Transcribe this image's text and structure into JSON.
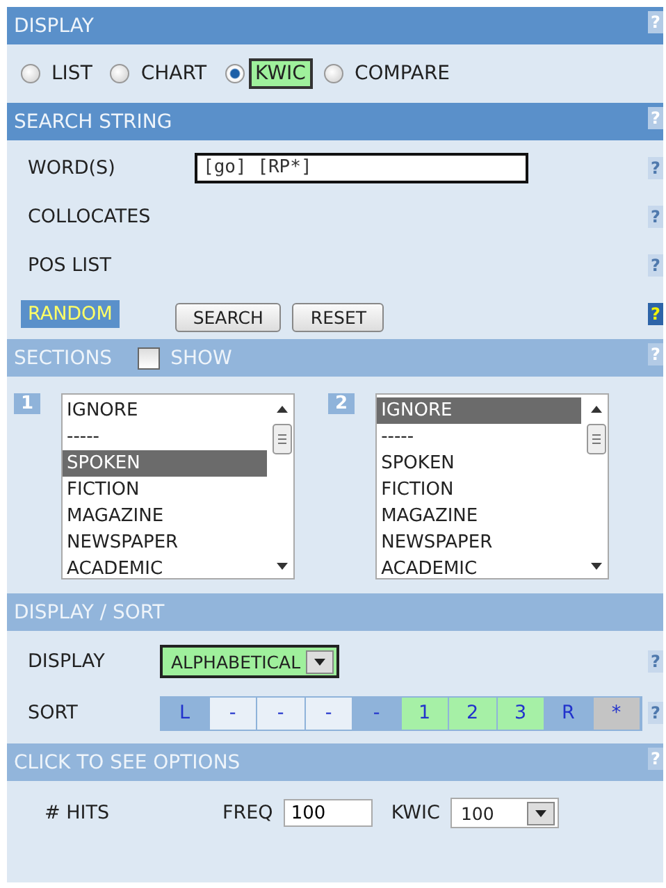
{
  "display": {
    "title": "DISPLAY",
    "dark": true,
    "help": "?",
    "options": [
      {
        "label": "LIST",
        "selected": false
      },
      {
        "label": "CHART",
        "selected": false
      },
      {
        "label": "KWIC",
        "selected": true
      },
      {
        "label": "COMPARE",
        "selected": false
      }
    ]
  },
  "search_string": {
    "title": "SEARCH STRING",
    "dark": true,
    "help": "?",
    "rows": [
      {
        "kind": "input",
        "label": "WORD(S)",
        "value": "[go] [RP*]",
        "help": "?"
      },
      {
        "kind": "plain",
        "label": "COLLOCATES",
        "help": "?"
      },
      {
        "kind": "plain",
        "label": "POS LIST",
        "help": "?"
      },
      {
        "kind": "buttons",
        "label": "RANDOM",
        "buttons": [
          "SEARCH",
          "RESET"
        ],
        "help": "?"
      }
    ]
  },
  "sections": {
    "title": "SECTIONS",
    "dark": false,
    "help": "?",
    "show": {
      "label": "SHOW",
      "checked": false
    },
    "lists": [
      {
        "number": "1",
        "items": [
          {
            "label": "IGNORE",
            "selected": false
          },
          {
            "label": "-----",
            "selected": false
          },
          {
            "label": "SPOKEN",
            "selected": true
          },
          {
            "label": "FICTION",
            "selected": false
          },
          {
            "label": "MAGAZINE",
            "selected": false
          },
          {
            "label": "NEWSPAPER",
            "selected": false
          },
          {
            "label": "ACADEMIC",
            "selected": false
          }
        ]
      },
      {
        "number": "2",
        "items": [
          {
            "label": "IGNORE",
            "selected": true
          },
          {
            "label": "-----",
            "selected": false
          },
          {
            "label": "SPOKEN",
            "selected": false
          },
          {
            "label": "FICTION",
            "selected": false
          },
          {
            "label": "MAGAZINE",
            "selected": false
          },
          {
            "label": "NEWSPAPER",
            "selected": false
          },
          {
            "label": "ACADEMIC",
            "selected": false
          }
        ]
      }
    ]
  },
  "display_sort": {
    "title": "DISPLAY / SORT",
    "dark": false,
    "display": {
      "label": "DISPLAY",
      "value": "ALPHABETICAL",
      "help": "?"
    },
    "sort": {
      "label": "SORT",
      "help": "?",
      "cells": [
        {
          "label": "L",
          "color": "#8fb3da"
        },
        {
          "label": "-",
          "color": "#e9f0f8"
        },
        {
          "label": "-",
          "color": "#e9f0f8"
        },
        {
          "label": "-",
          "color": "#e9f0f8"
        },
        {
          "label": "-",
          "color": "#8fb3da"
        },
        {
          "label": "1",
          "color": "#a6f0a6"
        },
        {
          "label": "2",
          "color": "#a6f0a6"
        },
        {
          "label": "3",
          "color": "#a6f0a6"
        },
        {
          "label": "R",
          "color": "#8fb3da"
        },
        {
          "label": "*",
          "color": "#c4c4c4"
        }
      ]
    }
  },
  "options": {
    "title": "CLICK TO SEE OPTIONS",
    "dark": false,
    "help": "?",
    "hits": {
      "label": "# HITS",
      "freq_label": "FREQ",
      "freq_value": "100",
      "kwic_label": "KWIC",
      "kwic_value": "100"
    }
  }
}
